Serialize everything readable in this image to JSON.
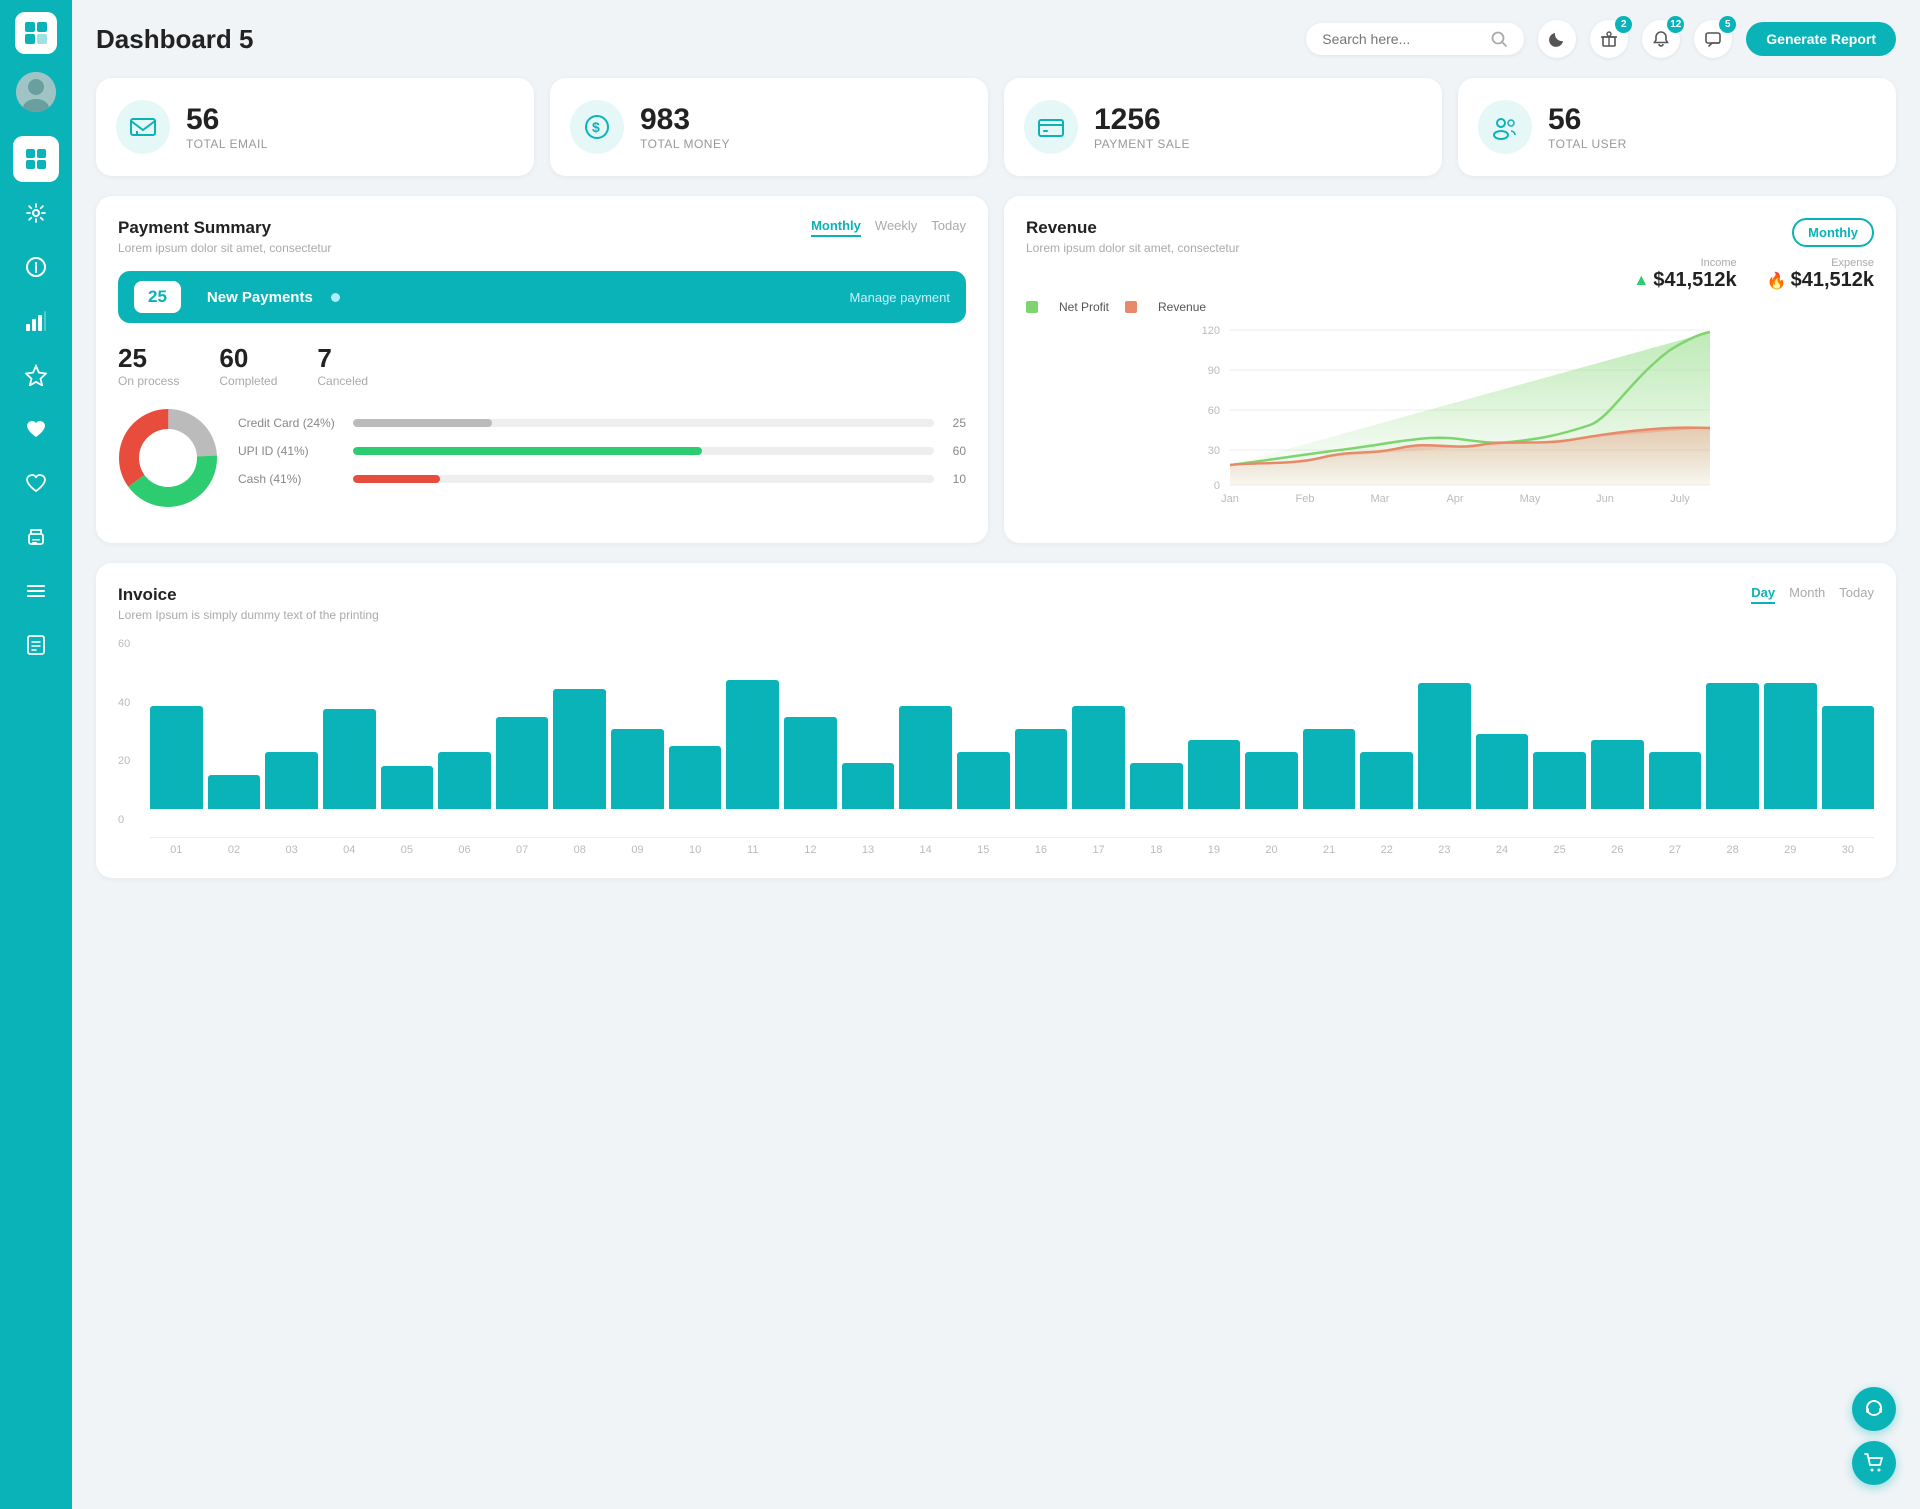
{
  "sidebar": {
    "logo_symbol": "🗂",
    "items": [
      {
        "id": "dashboard",
        "icon": "⊞",
        "active": true
      },
      {
        "id": "settings",
        "icon": "⚙"
      },
      {
        "id": "info",
        "icon": "ℹ"
      },
      {
        "id": "analytics",
        "icon": "📊"
      },
      {
        "id": "favorites",
        "icon": "★"
      },
      {
        "id": "heart",
        "icon": "♥"
      },
      {
        "id": "heart2",
        "icon": "♡"
      },
      {
        "id": "print",
        "icon": "🖨"
      },
      {
        "id": "list",
        "icon": "☰"
      },
      {
        "id": "docs",
        "icon": "📋"
      }
    ]
  },
  "header": {
    "title": "Dashboard 5",
    "search_placeholder": "Search here...",
    "badge_bell": "2",
    "badge_notification": "12",
    "badge_message": "5",
    "generate_btn": "Generate Report"
  },
  "stat_cards": [
    {
      "id": "email",
      "number": "56",
      "label": "TOTAL EMAIL",
      "icon": "📋"
    },
    {
      "id": "money",
      "number": "983",
      "label": "TOTAL MONEY",
      "icon": "$"
    },
    {
      "id": "payment",
      "number": "1256",
      "label": "PAYMENT SALE",
      "icon": "💳"
    },
    {
      "id": "user",
      "number": "56",
      "label": "TOTAL USER",
      "icon": "👥"
    }
  ],
  "payment_summary": {
    "title": "Payment Summary",
    "subtitle": "Lorem ipsum dolor sit amet, consectetur",
    "tabs": [
      "Monthly",
      "Weekly",
      "Today"
    ],
    "active_tab": "Monthly",
    "new_payments_count": "25",
    "new_payments_label": "New Payments",
    "manage_link": "Manage payment",
    "stats": [
      {
        "num": "25",
        "label": "On process"
      },
      {
        "num": "60",
        "label": "Completed"
      },
      {
        "num": "7",
        "label": "Canceled"
      }
    ],
    "payment_methods": [
      {
        "label": "Credit Card (24%)",
        "pct": 24,
        "color": "#bbb",
        "val": "25"
      },
      {
        "label": "UPI ID (41%)",
        "pct": 60,
        "color": "#2ecc71",
        "val": "60"
      },
      {
        "label": "Cash (41%)",
        "pct": 15,
        "color": "#e74c3c",
        "val": "10"
      }
    ],
    "donut": {
      "segments": [
        {
          "pct": 24,
          "color": "#bbb"
        },
        {
          "pct": 41,
          "color": "#2ecc71"
        },
        {
          "pct": 35,
          "color": "#e74c3c"
        }
      ]
    }
  },
  "revenue": {
    "title": "Revenue",
    "subtitle": "Lorem ipsum dolor sit amet, consectetur",
    "active_tab": "Monthly",
    "income_label": "Income",
    "income_value": "$41,512k",
    "expense_label": "Expense",
    "expense_value": "$41,512k",
    "legend": [
      {
        "label": "Net Profit",
        "color": "#7ed56f"
      },
      {
        "label": "Revenue",
        "color": "#e8896a"
      }
    ],
    "x_labels": [
      "Jan",
      "Feb",
      "Mar",
      "Apr",
      "May",
      "Jun",
      "July"
    ],
    "y_labels": [
      "120",
      "90",
      "60",
      "30",
      "0"
    ]
  },
  "invoice": {
    "title": "Invoice",
    "subtitle": "Lorem Ipsum is simply dummy text of the printing",
    "tabs": [
      "Day",
      "Month",
      "Today"
    ],
    "active_tab": "Day",
    "y_labels": [
      "60",
      "40",
      "20",
      "0"
    ],
    "x_labels": [
      "01",
      "02",
      "03",
      "04",
      "05",
      "06",
      "07",
      "08",
      "09",
      "10",
      "11",
      "12",
      "13",
      "14",
      "15",
      "16",
      "17",
      "18",
      "19",
      "20",
      "21",
      "22",
      "23",
      "24",
      "25",
      "26",
      "27",
      "28",
      "29",
      "30"
    ],
    "bars": [
      36,
      12,
      20,
      35,
      15,
      20,
      32,
      42,
      28,
      22,
      45,
      32,
      16,
      36,
      20,
      28,
      36,
      16,
      24,
      20,
      28,
      20,
      44,
      26,
      20,
      24,
      20,
      44,
      44,
      36
    ]
  },
  "fab": [
    {
      "id": "support",
      "icon": "🎧"
    },
    {
      "id": "cart",
      "icon": "🛒"
    }
  ]
}
